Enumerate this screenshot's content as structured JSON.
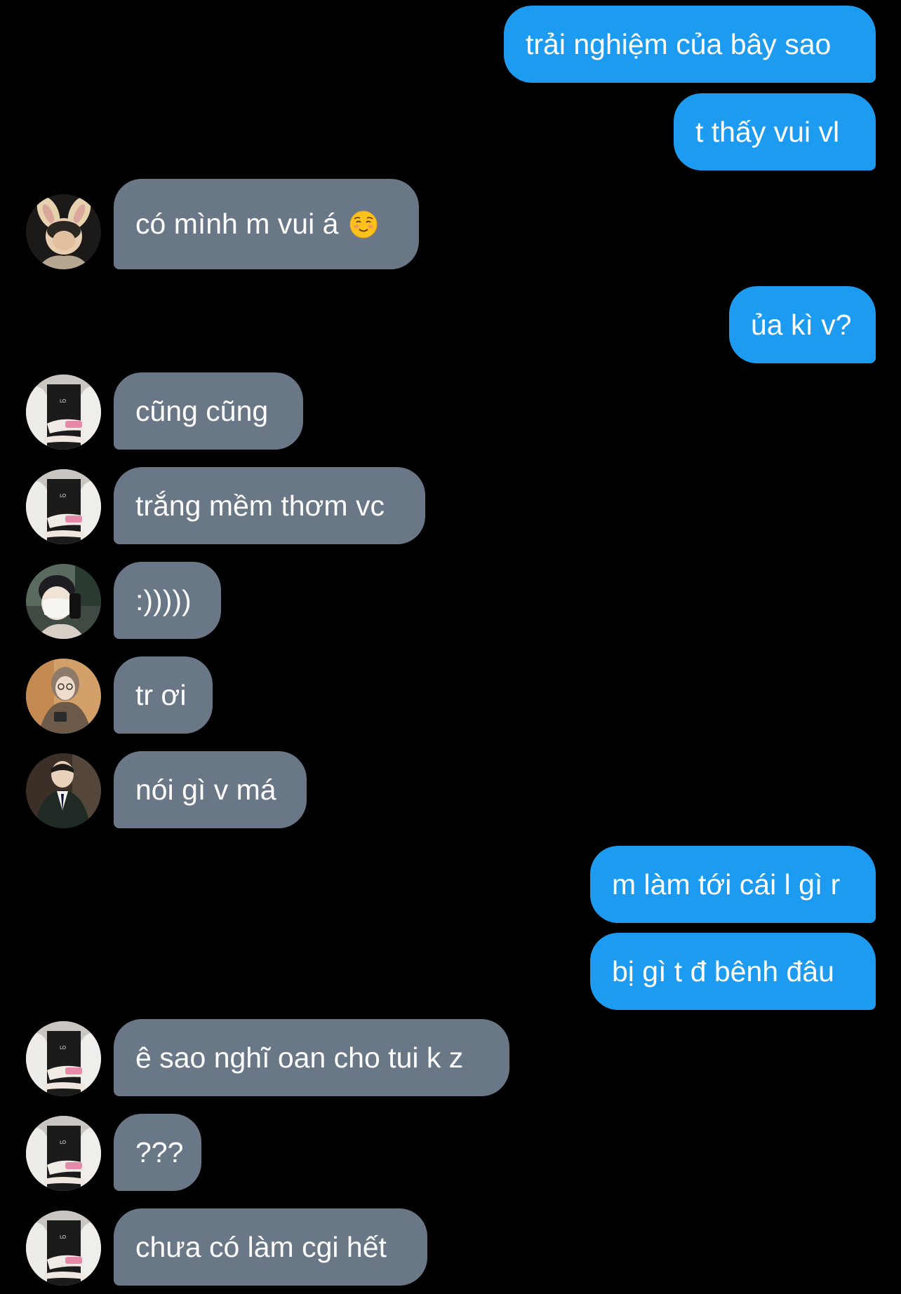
{
  "messages": [
    {
      "side": "out",
      "text": "trải nghiệm của bây sao"
    },
    {
      "side": "out",
      "text": "t thấy vui vl"
    },
    {
      "side": "in",
      "avatar": "bunny-ears-avatar",
      "text": "có mình m vui á",
      "emoji": "smiling-blush-emoji"
    },
    {
      "side": "out",
      "text": "ủa kì v?"
    },
    {
      "side": "in",
      "avatar": "white-jacket-avatar",
      "text": "cũng cũng"
    },
    {
      "side": "in",
      "avatar": "white-jacket-avatar",
      "text": "trắng mềm thơm vc"
    },
    {
      "side": "in",
      "avatar": "mask-selfie-avatar",
      "text": ":)))))"
    },
    {
      "side": "in",
      "avatar": "glasses-girl-avatar",
      "text": "tr ơi"
    },
    {
      "side": "in",
      "avatar": "suit-avatar",
      "text": "nói gì v má"
    },
    {
      "side": "out",
      "text": "m làm tới cái l gì r"
    },
    {
      "side": "out",
      "text": "bị gì t đ bênh đâu"
    },
    {
      "side": "in",
      "avatar": "white-jacket-avatar",
      "text": "ê sao nghĩ oan cho tui k z"
    },
    {
      "side": "in",
      "avatar": "white-jacket-avatar",
      "text": "???"
    },
    {
      "side": "in",
      "avatar": "white-jacket-avatar",
      "text": "chưa có làm cgi hết"
    }
  ],
  "colors": {
    "background": "#000000",
    "outgoing_bubble": "#1d9bf0",
    "incoming_bubble": "#697786",
    "text": "#ffffff"
  }
}
